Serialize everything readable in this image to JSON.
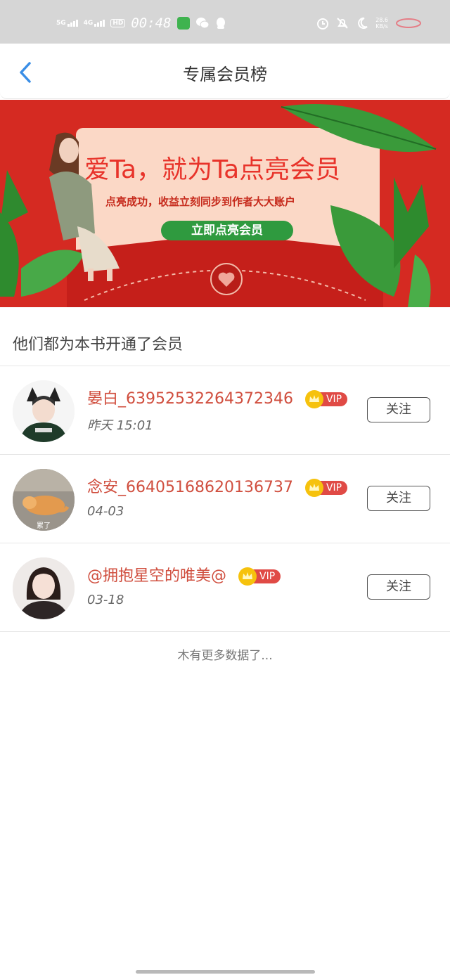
{
  "status_bar": {
    "net1": "5G",
    "net2": "4G",
    "hd": "HD",
    "time": "00:48",
    "speed": "28.6",
    "speed_unit": "KB/s"
  },
  "header": {
    "title": "专属会员榜"
  },
  "banner": {
    "headline": "爱Ta，就为Ta点亮会员",
    "subtitle": "点亮成功，收益立刻同步到作者大大账户",
    "button": "立即点亮会员",
    "colors": {
      "background": "#d52a22",
      "card": "#fbd8c6",
      "button": "#2f9a3f"
    }
  },
  "section": {
    "title": "他们都为本书开通了会员"
  },
  "members": [
    {
      "name": "晏白_63952532264372346",
      "badge": "VIP",
      "date": "昨天 15:01",
      "follow": "关注",
      "avatar_text": ""
    },
    {
      "name": "念安_66405168620136737",
      "badge": "VIP",
      "date": "04-03",
      "follow": "关注",
      "avatar_text": "累了"
    },
    {
      "name": "@拥抱星空的唯美@",
      "badge": "VIP",
      "date": "03-18",
      "follow": "关注",
      "avatar_text": ""
    }
  ],
  "footer": {
    "no_more": "木有更多数据了..."
  },
  "colors": {
    "name": "#d04e3e",
    "vip": "#e04a45",
    "crown": "#f6c20d",
    "back_arrow": "#3a8ee6"
  }
}
